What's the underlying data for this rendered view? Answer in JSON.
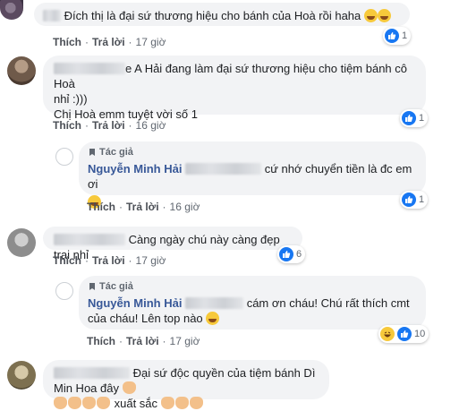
{
  "actions": {
    "like_label": "Thích",
    "reply_label": "Trả lời",
    "separator": "·"
  },
  "author_badge": "Tác giả",
  "comments": [
    {
      "text": "Đích thị là đại sứ thương hiệu cho bánh của Hoà rồi haha",
      "time": "17 giờ",
      "reaction_count": "1"
    },
    {
      "text_line1": "e A Hải đang làm đại sứ thương hiệu cho tiệm bánh cô Hoà",
      "text_line2": "nhỉ :)))",
      "text_line3": "Chị Hoà emm tuyệt vời số 1",
      "time": "16 giờ",
      "reaction_count": "1"
    },
    {
      "author": "Nguyễn Minh Hải",
      "text": "cứ nhớ chuyển tiền là đc em ơi",
      "time": "16 giờ",
      "reaction_count": "1"
    },
    {
      "text": "Càng ngày chú này càng đẹp trai nhỉ",
      "time": "17 giờ",
      "reaction_count": "6"
    },
    {
      "author": "Nguyễn Minh Hải",
      "text_line1": "cám ơn cháu! Chú rất thích cmt",
      "text_line2": "của cháu! Lên top nào",
      "time": "17 giờ",
      "reaction_count": "10"
    },
    {
      "text_line1": "Đại sứ độc quyền của tiệm bánh Dì Min Hoa đây",
      "text_line2": "xuất sắc"
    }
  ],
  "icons": [
    "like-icon",
    "haha-icon",
    "badge-icon",
    "clap-icon"
  ],
  "colors": {
    "link": "#385898",
    "bubble": "#f2f3f5",
    "like": "#1877f2",
    "meta": "#606770"
  }
}
